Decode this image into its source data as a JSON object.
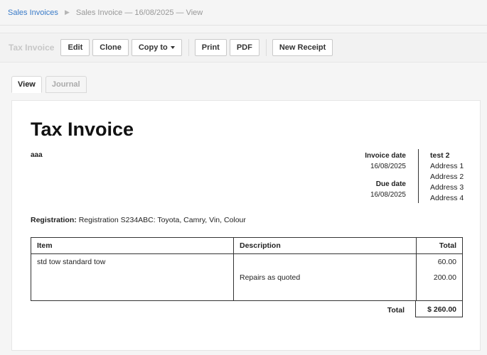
{
  "breadcrumb": {
    "parent": "Sales Invoices",
    "current": "Sales Invoice — 16/08/2025 — View"
  },
  "toolbar": {
    "title": "Tax Invoice",
    "edit": "Edit",
    "clone": "Clone",
    "copy_to": "Copy to",
    "print": "Print",
    "pdf": "PDF",
    "new_receipt": "New Receipt"
  },
  "tabs": [
    {
      "label": "View",
      "active": true
    },
    {
      "label": "Journal",
      "active": false
    }
  ],
  "invoice": {
    "title": "Tax Invoice",
    "customer": "aaa",
    "invoice_date_label": "Invoice date",
    "invoice_date": "16/08/2025",
    "due_date_label": "Due date",
    "due_date": "16/08/2025",
    "address": {
      "name": "test 2",
      "line1": "Address 1",
      "line2": "Address 2",
      "line3": "Address 3",
      "line4": "Address 4"
    },
    "registration_label": "Registration:",
    "registration_value": "Registration S234ABC: Toyota, Camry, Vin, Colour",
    "columns": {
      "item": "Item",
      "description": "Description",
      "total": "Total"
    },
    "lines": [
      {
        "item": "std tow standard tow",
        "description": "",
        "total": "60.00"
      },
      {
        "item": "",
        "description": "Repairs as quoted",
        "total": "200.00"
      }
    ],
    "total_label": "Total",
    "total_value": "$ 260.00"
  }
}
